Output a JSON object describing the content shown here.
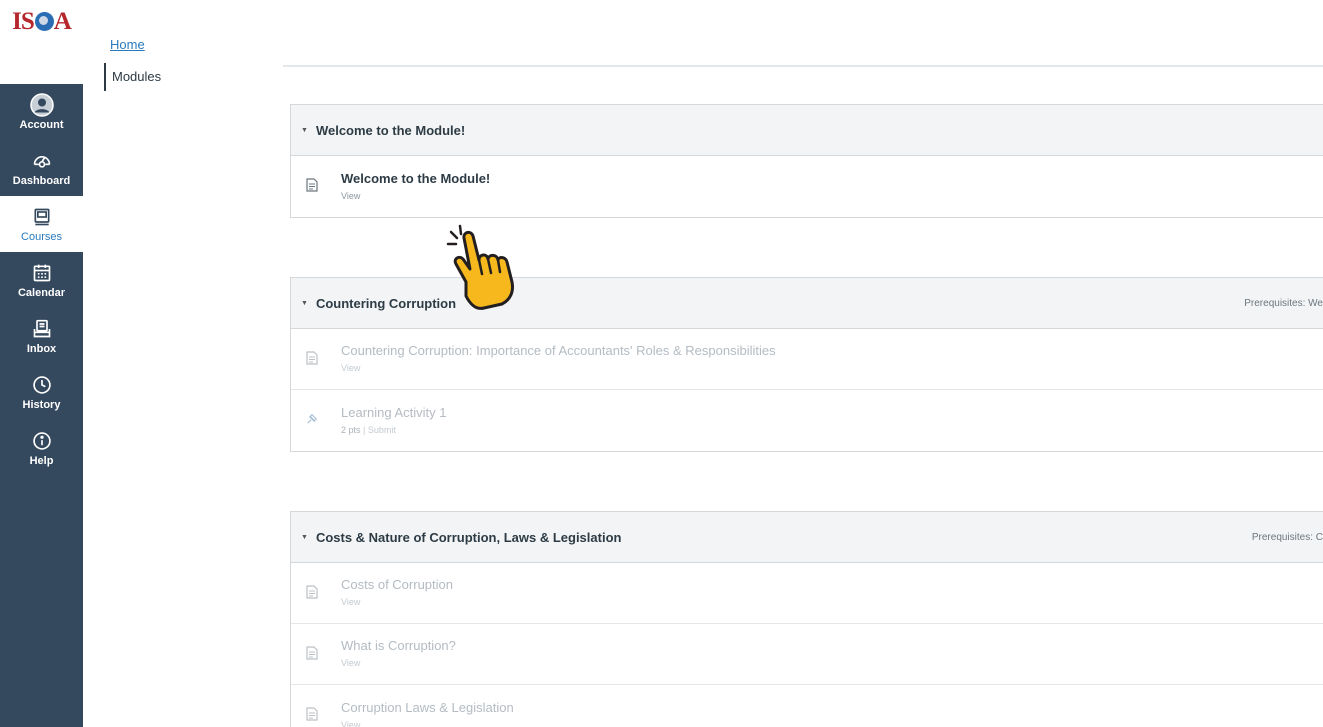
{
  "logo": {
    "text_left": "IS",
    "text_right": "A"
  },
  "global_nav": {
    "items": [
      {
        "label": "Account",
        "icon": "account-icon",
        "active": false
      },
      {
        "label": "Dashboard",
        "icon": "dashboard-icon",
        "active": false
      },
      {
        "label": "Courses",
        "icon": "courses-icon",
        "active": true
      },
      {
        "label": "Calendar",
        "icon": "calendar-icon",
        "active": false
      },
      {
        "label": "Inbox",
        "icon": "inbox-icon",
        "active": false
      },
      {
        "label": "History",
        "icon": "history-icon",
        "active": false
      },
      {
        "label": "Help",
        "icon": "help-icon",
        "active": false
      }
    ]
  },
  "breadcrumb": {
    "home": "Home"
  },
  "course_nav": {
    "current": "Modules"
  },
  "modules": [
    {
      "title": "Welcome to the Module!",
      "prerequisites": "",
      "items": [
        {
          "title": "Welcome to the Module!",
          "sub": "View",
          "icon": "page-icon"
        }
      ]
    },
    {
      "title": "Countering Corruption",
      "prerequisites": "Prerequisites: We",
      "items": [
        {
          "title": "Countering Corruption: Importance of Accountants' Roles & Responsibilities",
          "sub": "View",
          "icon": "page-icon"
        },
        {
          "title": "Learning Activity 1",
          "pts": "2 pts",
          "sub": "Submit",
          "icon": "assignment-icon"
        }
      ]
    },
    {
      "title": "Costs & Nature of Corruption, Laws & Legislation",
      "prerequisites": "Prerequisites: C",
      "items": [
        {
          "title": "Costs of Corruption",
          "sub": "View",
          "icon": "page-icon"
        },
        {
          "title": "What is Corruption?",
          "sub": "View",
          "icon": "page-icon"
        },
        {
          "title": "Corruption Laws & Legislation",
          "sub": "View",
          "icon": "page-icon"
        }
      ]
    }
  ],
  "colors": {
    "nav_bg": "#35495e",
    "brand_red": "#b5272d",
    "link_blue": "#2b7abc",
    "hand_yellow": "#f6b81c"
  }
}
